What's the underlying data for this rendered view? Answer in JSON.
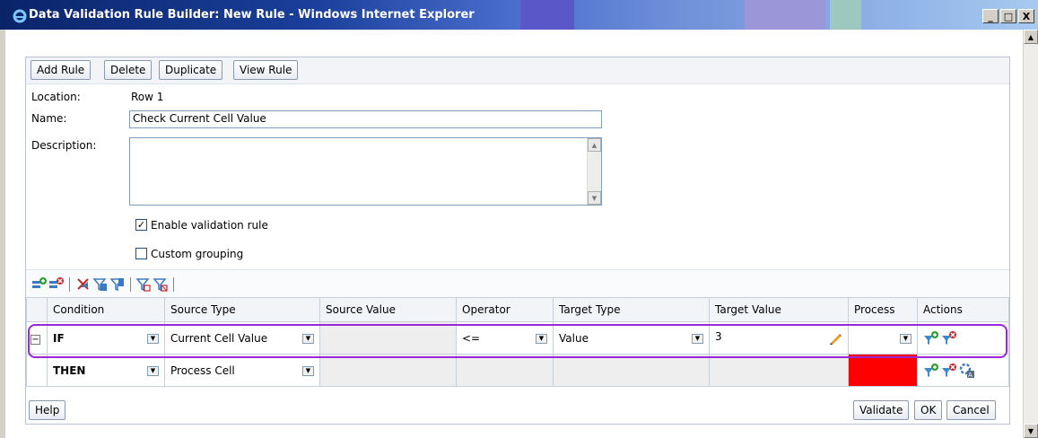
{
  "window": {
    "title": "Data Validation Rule Builder: New Rule - Windows Internet Explorer",
    "minimize": "_",
    "maximize": "□",
    "close": "X"
  },
  "toolbar": {
    "add_rule": "Add Rule",
    "delete": "Delete",
    "duplicate": "Duplicate",
    "view_rule": "View Rule"
  },
  "form": {
    "location_label": "Location:",
    "location_value": "Row 1",
    "name_label": "Name:",
    "name_value": "Check Current Cell Value",
    "description_label": "Description:",
    "description_value": "",
    "enable_label": "Enable validation rule",
    "enable_checked": true,
    "custom_grouping_label": "Custom grouping",
    "custom_grouping_checked": false
  },
  "grid": {
    "columns": [
      "Condition",
      "Source Type",
      "Source Value",
      "Operator",
      "Target Type",
      "Target Value",
      "Process",
      "Actions"
    ],
    "rows": [
      {
        "expander": "−",
        "condition": "IF",
        "source_type": "Current Cell Value",
        "source_value": "",
        "operator": "<=",
        "target_type": "Value",
        "target_value": "3",
        "process": ""
      },
      {
        "expander": "",
        "condition": "THEN",
        "source_type": "Process Cell",
        "source_value": "",
        "operator": "",
        "target_type": "",
        "target_value": "",
        "process_color": "#ff0000"
      }
    ]
  },
  "footer": {
    "help": "Help",
    "validate": "Validate",
    "ok": "OK",
    "cancel": "Cancel"
  },
  "colors": {
    "highlight": "#9c27d9",
    "process_cell": "#ff0000",
    "title_bar": "#0a246a"
  },
  "icons": [
    "ie-icon",
    "add-condition-icon",
    "delete-condition-icon",
    "cut-icon",
    "copy-icon",
    "paste-icon",
    "add-range-icon",
    "delete-range-icon",
    "add-condition-action-icon",
    "delete-condition-action-icon",
    "format-action-icon",
    "pencil-icon"
  ]
}
